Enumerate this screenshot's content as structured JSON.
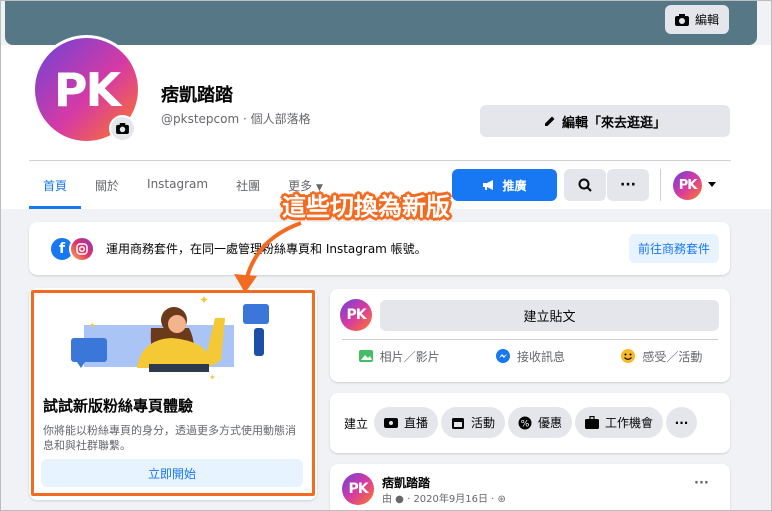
{
  "cover": {
    "edit_label": "編輯"
  },
  "page": {
    "avatar_text": "PK",
    "name": "痞凱踏踏",
    "handle": "@pkstepcom · 個人部落格",
    "edit_button": "編輯「來去逛逛」"
  },
  "tabs": [
    {
      "label": "首頁"
    },
    {
      "label": "關於"
    },
    {
      "label": "Instagram"
    },
    {
      "label": "社團"
    },
    {
      "label": "更多"
    }
  ],
  "actions": {
    "promote_label": "推廣"
  },
  "business": {
    "text": "運用商務套件，在同一處管理粉絲專頁和 Instagram 帳號。",
    "button": "前往商務套件"
  },
  "try_card": {
    "title": "試試新版粉絲專頁體驗",
    "description": "你將能以粉絲專頁的身分，透過更多方式使用動態消息和與社群聯繫。",
    "button": "立即開始"
  },
  "composer": {
    "create_post": "建立貼文",
    "actions": [
      {
        "label": "相片／影片",
        "icon": "photo-icon",
        "color": "#45bd62"
      },
      {
        "label": "接收訊息",
        "icon": "messenger-icon",
        "color": "#1877f2"
      },
      {
        "label": "感受／活動",
        "icon": "emoji-icon",
        "color": "#f7b928"
      }
    ]
  },
  "create": {
    "label": "建立",
    "chips": [
      {
        "label": "直播",
        "icon": "live-icon"
      },
      {
        "label": "活動",
        "icon": "calendar-icon"
      },
      {
        "label": "優惠",
        "icon": "offer-icon"
      },
      {
        "label": "工作機會",
        "icon": "briefcase-icon"
      }
    ]
  },
  "feed": {
    "author": "痞凱踏踏",
    "meta": "由 ● · 2020年9月16日 · ⊛"
  },
  "annotation": {
    "text": "這些切換為新版",
    "color": "#f36b21"
  }
}
